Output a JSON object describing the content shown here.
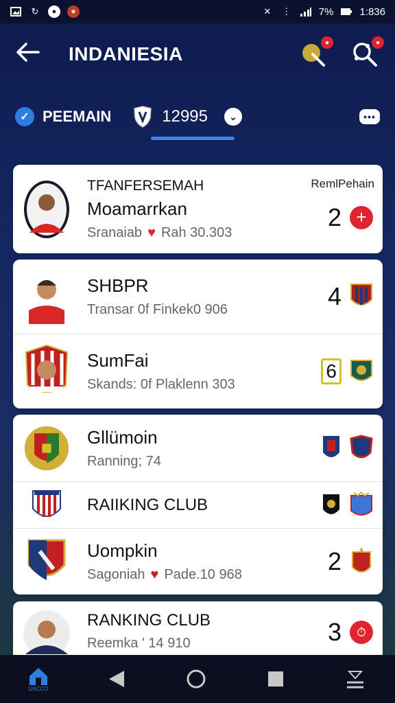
{
  "status_bar": {
    "time": "1:836",
    "battery": "7%"
  },
  "app_bar": {
    "title": "INDANIESIA",
    "back_icon": "arrow-left-icon",
    "icons": [
      "whistle-icon",
      "search-people-icon"
    ]
  },
  "filter_bar": {
    "label": "PEEMAIN",
    "count": "12995"
  },
  "cards": [
    {
      "rows": [
        {
          "caption": "TFANFERSEMAH",
          "name": "Moamarrkan",
          "sub": "Sranaiab",
          "sub_value": "Rah 30.303",
          "top_right": "RemlPehain",
          "number": "2",
          "action": "plus"
        }
      ]
    },
    {
      "rows": [
        {
          "name": "SHBPR",
          "sub": "Transar 0f  Finkek0 906",
          "number": "4"
        },
        {
          "name": "SumFai",
          "sub": "Skands: 0f  Plaklenn 303",
          "number": "6"
        }
      ]
    },
    {
      "rows": [
        {
          "name": "Gllümoin",
          "sub": "Ranning; 74"
        },
        {
          "name": "RAIIKING CLUB"
        },
        {
          "name": "Uompkin",
          "sub": "Sagoniah",
          "sub_value": "Pade.10 968",
          "number": "2"
        }
      ]
    },
    {
      "rows": [
        {
          "name": "RANKING CLUB",
          "sub": "Reemka ' 14 910",
          "number": "3"
        }
      ]
    }
  ],
  "nav": {
    "home_label": "UACCO"
  },
  "colors": {
    "accent": "#2f7de1",
    "danger": "#e0242f",
    "background_top": "#0d1a4d"
  }
}
